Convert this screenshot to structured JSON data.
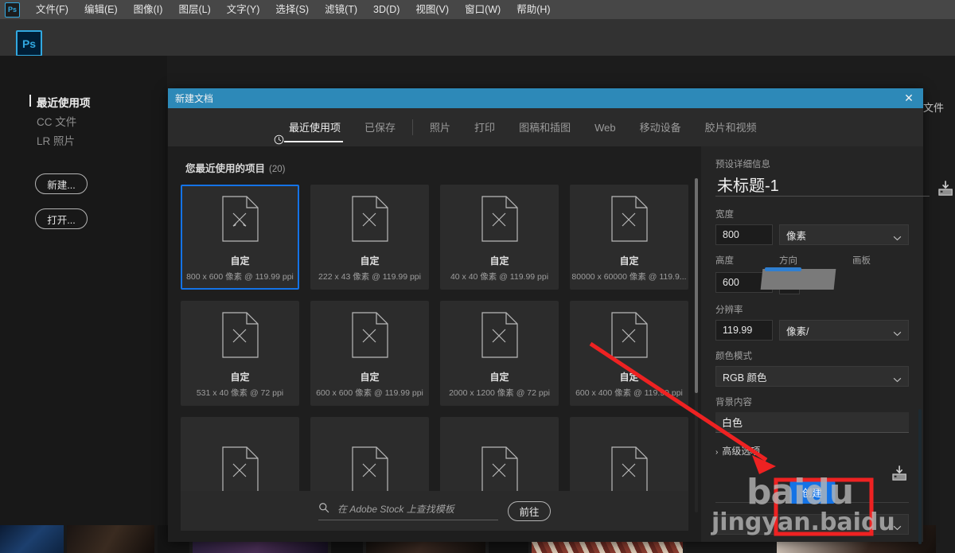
{
  "app": {
    "logo_text": "Ps",
    "menubar": [
      {
        "label": "文件(F)",
        "name": "menu-file"
      },
      {
        "label": "编辑(E)",
        "name": "menu-edit"
      },
      {
        "label": "图像(I)",
        "name": "menu-image"
      },
      {
        "label": "图层(L)",
        "name": "menu-layer"
      },
      {
        "label": "文字(Y)",
        "name": "menu-type"
      },
      {
        "label": "选择(S)",
        "name": "menu-select"
      },
      {
        "label": "滤镜(T)",
        "name": "menu-filter"
      },
      {
        "label": "3D(D)",
        "name": "menu-3d"
      },
      {
        "label": "视图(V)",
        "name": "menu-view"
      },
      {
        "label": "窗口(W)",
        "name": "menu-window"
      },
      {
        "label": "帮助(H)",
        "name": "menu-help"
      }
    ]
  },
  "home": {
    "nav": [
      {
        "label": "最近使用项",
        "active": true
      },
      {
        "label": "CC 文件",
        "active": false
      },
      {
        "label": "LR 照片",
        "active": false
      }
    ],
    "buttons": [
      {
        "label": "新建...",
        "name": "home-new-button"
      },
      {
        "label": "打开...",
        "name": "home-open-button"
      }
    ],
    "background_label": "的文件"
  },
  "dialog": {
    "title": "新建文档",
    "close_glyph": "✕",
    "tabs": [
      {
        "label": "最近使用项",
        "icon": "clock-icon",
        "active": true
      },
      {
        "label": "已保存",
        "icon": "",
        "active": false
      },
      {
        "label": "照片",
        "icon": "",
        "active": false
      },
      {
        "label": "打印",
        "icon": "",
        "active": false
      },
      {
        "label": "图稿和插图",
        "icon": "",
        "active": false
      },
      {
        "label": "Web",
        "icon": "",
        "active": false
      },
      {
        "label": "移动设备",
        "icon": "",
        "active": false
      },
      {
        "label": "胶片和视频",
        "icon": "",
        "active": false
      }
    ],
    "recent": {
      "heading": "您最近使用的项目",
      "count": "(20)",
      "items": [
        {
          "name": "自定",
          "meta": "800 x 600 像素 @ 119.99 ppi",
          "selected": true
        },
        {
          "name": "自定",
          "meta": "222 x 43 像素 @ 119.99 ppi",
          "selected": false
        },
        {
          "name": "自定",
          "meta": "40 x 40 像素 @ 119.99 ppi",
          "selected": false
        },
        {
          "name": "自定",
          "meta": "80000 x 60000 像素 @ 119.9...",
          "selected": false
        },
        {
          "name": "自定",
          "meta": "531 x 40 像素 @ 72 ppi",
          "selected": false
        },
        {
          "name": "自定",
          "meta": "600 x 600 像素 @ 119.99 ppi",
          "selected": false
        },
        {
          "name": "自定",
          "meta": "2000 x 1200 像素 @ 72 ppi",
          "selected": false
        },
        {
          "name": "自定",
          "meta": "600 x 400 像素 @ 119.99 ppi",
          "selected": false
        },
        {
          "name": "",
          "meta": "",
          "selected": false
        },
        {
          "name": "",
          "meta": "",
          "selected": false
        },
        {
          "name": "",
          "meta": "",
          "selected": false
        },
        {
          "name": "",
          "meta": "",
          "selected": false
        }
      ]
    },
    "stock": {
      "placeholder": "在 Adobe Stock 上查找模板",
      "value": "",
      "go_label": "前往",
      "search_icon": "search-icon"
    },
    "preset": {
      "section_label": "预设详细信息",
      "doc_name": "未标题-1",
      "width_label": "宽度",
      "width_value": "800",
      "width_unit": "像素",
      "height_label": "高度",
      "height_value": "600",
      "orientation_label": "方向",
      "artboard_label": "画板",
      "resolution_label": "分辨率",
      "resolution_value": "119.99",
      "resolution_unit": "像素/",
      "color_mode_label": "颜色模式",
      "color_mode_value": "RGB 颜色",
      "bg_content_label": "背景内容",
      "bg_content_value": "白色",
      "advanced_label": "高级选项",
      "advanced_arrow": "›",
      "create_label": "创建"
    }
  },
  "annotations": {
    "watermark_primary": "baidu",
    "watermark_secondary": "jingyan.baidu",
    "arrow_color": "#ee2222"
  },
  "colors": {
    "dialog_title_bar": "#2d89b8",
    "accent_blue": "#1473e6",
    "ps_brand": "#31a8e0"
  }
}
